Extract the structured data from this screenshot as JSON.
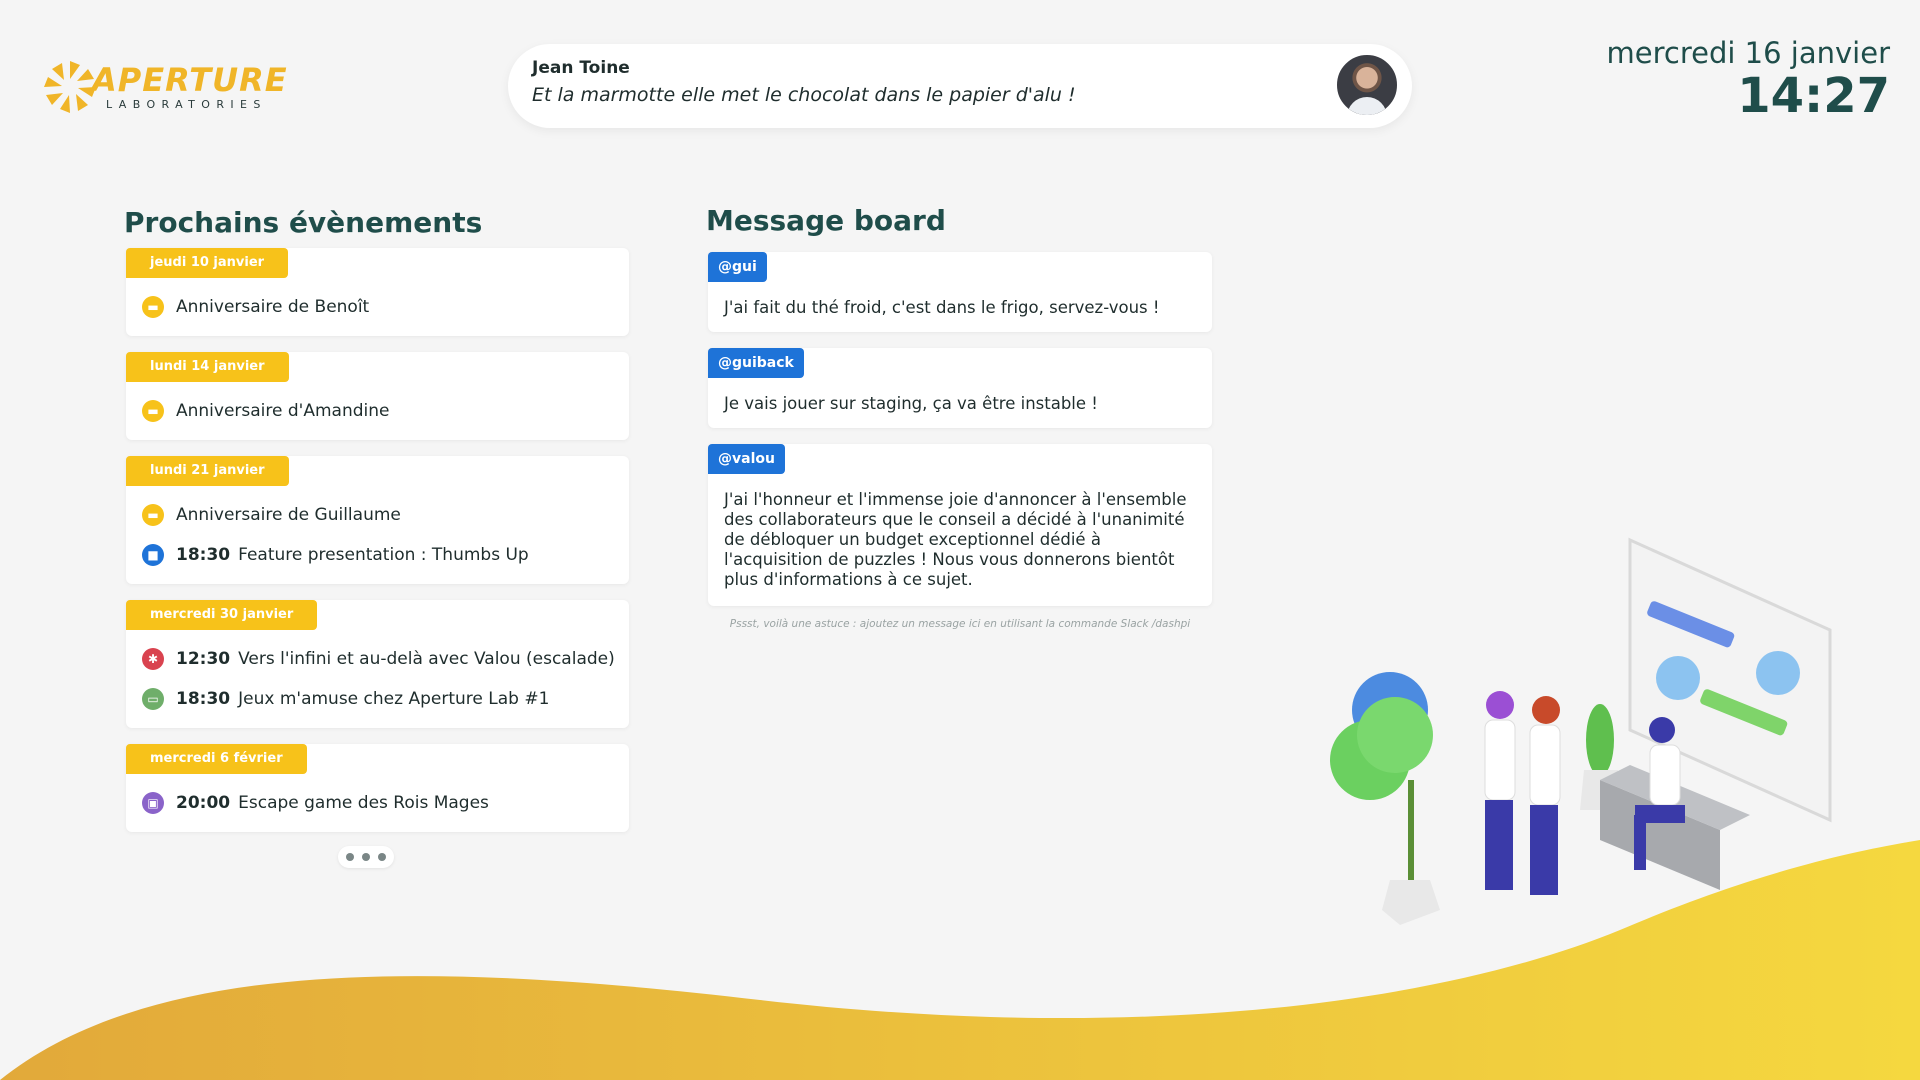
{
  "logo": {
    "word": "APERTURE",
    "sub": "LABORATORIES"
  },
  "quote": {
    "author": "Jean Toine",
    "text": "Et la marmotte elle met le chocolat dans le papier d'alu !"
  },
  "clock": {
    "date": "mercredi 16 janvier",
    "time": "14:27"
  },
  "events": {
    "title": "Prochains évènements",
    "days": [
      {
        "date": "jeudi 10 janvier",
        "items": [
          {
            "icon": "cake-icon",
            "time": "",
            "label": "Anniversaire de Benoît"
          }
        ]
      },
      {
        "date": "lundi 14 janvier",
        "items": [
          {
            "icon": "cake-icon",
            "time": "",
            "label": "Anniversaire d'Amandine"
          }
        ]
      },
      {
        "date": "lundi 21 janvier",
        "items": [
          {
            "icon": "cake-icon",
            "time": "",
            "label": "Anniversaire de Guillaume"
          },
          {
            "icon": "briefcase-icon",
            "time": "18:30",
            "label": "Feature presentation : Thumbs Up"
          }
        ]
      },
      {
        "date": "mercredi 30 janvier",
        "items": [
          {
            "icon": "climbing-icon",
            "time": "12:30",
            "label": "Vers l'infini et au-delà avec Valou (escalade)"
          },
          {
            "icon": "gamepad-icon",
            "time": "18:30",
            "label": "Jeux m'amuse chez Aperture Lab #1"
          }
        ]
      },
      {
        "date": "mercredi 6 février",
        "items": [
          {
            "icon": "ticket-icon",
            "time": "20:00",
            "label": "Escape game des Rois Mages"
          }
        ]
      }
    ]
  },
  "board": {
    "title": "Message board",
    "messages": [
      {
        "user": "@gui",
        "text": "J'ai fait du thé froid, c'est dans le frigo, servez-vous !"
      },
      {
        "user": "@guiback",
        "text": "Je vais jouer sur staging, ça va être instable !"
      },
      {
        "user": "@valou",
        "text": "J'ai l'honneur et l'immense joie d'annoncer à l'ensemble des collaborateurs que le conseil a décidé à l'unanimité de débloquer un budget exceptionnel dédié à l'acquisition de puzzles ! Nous vous donnerons bientôt plus d'informations à ce sujet."
      }
    ],
    "tip": "Pssst, voilà une astuce : ajoutez un message ici en utilisant la commande Slack /dashpi"
  },
  "colors": {
    "accent_yellow": "#f7c21a",
    "user_blue": "#1e73d8",
    "heading": "#1f4d4a",
    "background": "#f5f5f5"
  }
}
